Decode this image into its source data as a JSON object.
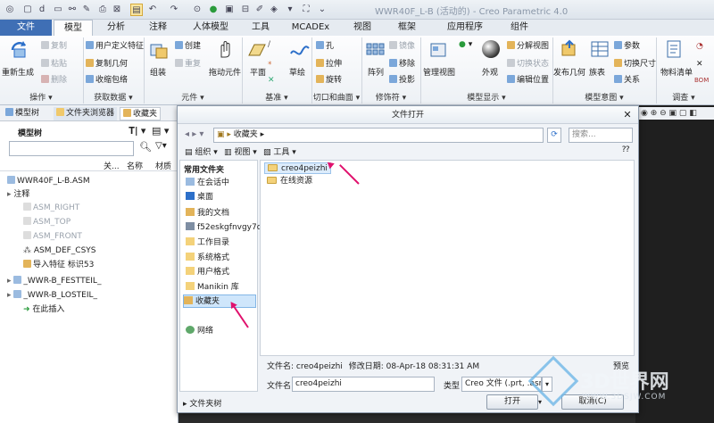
{
  "app": {
    "title": "WWR40F_L-B (活动的) - Creo Parametric 4.0"
  },
  "tabs": [
    "文件",
    "模型",
    "分析",
    "注释",
    "人体模型",
    "工具",
    "MCADEx",
    "视图",
    "框架",
    "应用程序",
    "组件"
  ],
  "ribbon": {
    "groups": {
      "operations": "操作 ▾",
      "get_data": "获取数据 ▾",
      "element": "元件 ▾",
      "datum": "基准 ▾",
      "cut_surface": "切口和曲面 ▾",
      "modifier": "修饰符 ▾",
      "model_display": "模型显示 ▾",
      "model_intent": "模型意图 ▾",
      "investigate": "调查 ▾"
    },
    "regenerate": "重新生成",
    "copy": "复制",
    "paste": "粘贴",
    "delete": "删除",
    "user_defined_feature": "用户定义特征",
    "copy_geometry": "复制几何",
    "shrinkwrap": "收缩包络",
    "assemble": "组装",
    "create": "创建",
    "repeat": "重复",
    "drag_components": "拖动元件",
    "plane": "平面",
    "sketch": "草绘",
    "hole": "孔",
    "extrude": "拉伸",
    "revolve": "旋转",
    "pattern": "阵列",
    "mirror": "镜像",
    "remove": "移除",
    "project": "投影",
    "manage_views": "管理视图",
    "appearance": "外观",
    "explode_view": "分解视图",
    "toggle_status": "切换状态",
    "edit_position": "编辑位置",
    "publish_geometry": "发布几何",
    "family_table": "族表",
    "parameters": "参数",
    "switch_dimensions": "切换尺寸",
    "relations": "关系",
    "bill_of_materials": "物料清单",
    "bom_extra": "BOM"
  },
  "left_panel": {
    "tabs": [
      "模型树",
      "文件夹浏览器",
      "收藏夹"
    ],
    "header": "模型树",
    "columns": [
      "关...",
      "名称",
      "材质"
    ],
    "tree": [
      {
        "label": "WWR40F_L-B.ASM",
        "dim": false
      },
      {
        "label": "注释",
        "dim": false
      },
      {
        "label": "ASM_RIGHT",
        "dim": true
      },
      {
        "label": "ASM_TOP",
        "dim": true
      },
      {
        "label": "ASM_FRONT",
        "dim": true
      },
      {
        "label": "ASM_DEF_CSYS",
        "dim": false
      },
      {
        "label": "导入特征 标识53",
        "dim": false
      },
      {
        "label": "_WWR-B_FESTTEIL_",
        "dim": false
      },
      {
        "label": "_WWR-B_LOSTEIL_",
        "dim": false
      },
      {
        "label": "在此插入",
        "dim": false
      }
    ]
  },
  "dialog": {
    "title": "文件打开",
    "path": "收藏夹",
    "search_placeholder": "搜索...",
    "toolbar": {
      "organize": "组织",
      "views": "视图",
      "tools": "工具"
    },
    "nav_header": "常用文件夹",
    "nav_items": [
      "在会话中",
      "桌面",
      "我的文档",
      "f52eskgfnvgy7q3",
      "工作目录",
      "系统格式",
      "用户格式",
      "Manikin 库",
      "收藏夹",
      "网络"
    ],
    "files": [
      "creo4peizhi",
      "在线资源"
    ],
    "info_name_label": "文件名:",
    "info_name_value": "creo4peizhi",
    "info_date_label": "修改日期:",
    "info_date_value": "08-Apr-18 08:31:31 AM",
    "preview": "预览",
    "filename_label": "文件名:",
    "filename_value": "creo4peizhi",
    "type_label": "类型",
    "type_value": "Creo 文件 (.prt, .asm,",
    "folder_tree": "文件夹树",
    "open": "打开",
    "cancel": "取消(C)"
  },
  "watermark": {
    "name": "3D世界网",
    "url": "WWW.3DSJW.COM"
  }
}
